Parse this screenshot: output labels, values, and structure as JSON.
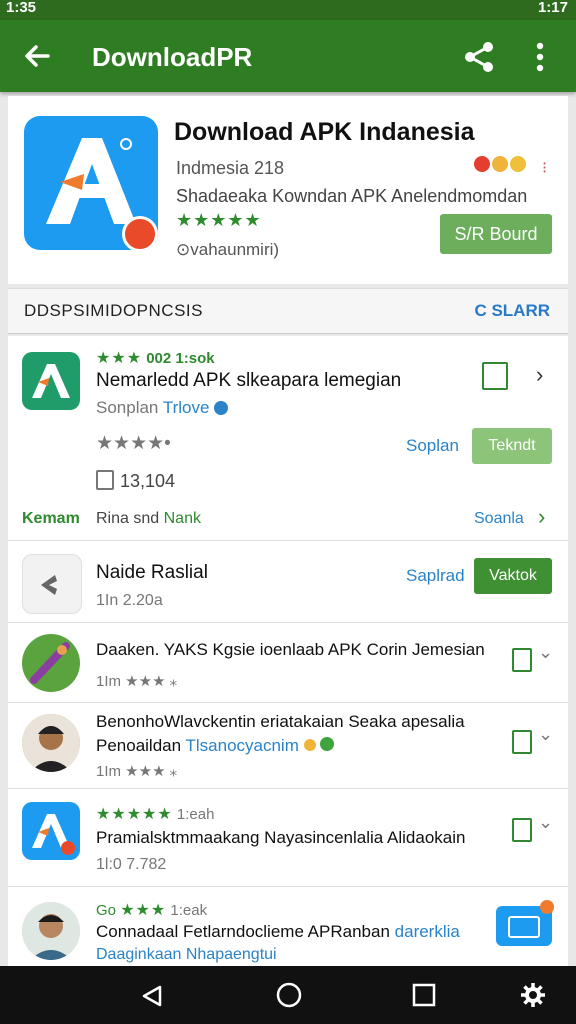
{
  "statusbar": {
    "left": "1:35",
    "right": "1:17"
  },
  "appbar": {
    "title": "DownloadPR"
  },
  "header_card": {
    "title": "Download APK Indanesia",
    "subtitle": "Indmesia 218",
    "description": "Shadaeaka Kowndan APK Anelendmomdan",
    "rating_stars": "★★★★★",
    "footer": "⊙vahaunmiri)",
    "button": "S/R Bourd"
  },
  "section": {
    "title": "DDSPSIMIDOPNCSIS",
    "action": "C SLARR"
  },
  "item1": {
    "stars": "★★★",
    "meta": "002 1:sok",
    "title": "Nemarledd APK slkeapara lemegian",
    "author_prefix": "Sonplan",
    "author": "Trlove",
    "rating": "★★★★•",
    "count": "13,104",
    "link_label": "Soplan",
    "button": "Tekndt"
  },
  "item1_footer": {
    "left": "Kemam",
    "middle": "Rina snd",
    "middle_green": "Nank",
    "right": "Soanla"
  },
  "item2": {
    "title": "Naide Raslial",
    "sub": "1In 2.20a",
    "link_label": "Saplrad",
    "button": "Vaktok"
  },
  "item3": {
    "title": "Daaken. YAKS Kgsie ioenlaab APK Corin Jemesian",
    "sub": "1Im ★★★ ⁎"
  },
  "item4": {
    "title1": "BenonhoWlavckentin eriatakaian Seaka apesalia",
    "title2_black": "Penoaildan",
    "title2_blue": "Tlsanocyacnim",
    "sub": "1Im ★★★ ⁎"
  },
  "item5": {
    "stars": "★★★★★",
    "meta": "1:eah",
    "title": "Pramialsktmmaakang Nayasincenlalia Alidaokain",
    "sub": "1l:0 7.782"
  },
  "item6": {
    "meta_prefix": "Go",
    "stars": "★★★",
    "meta": "1:eak",
    "title_black": "Connadaal Fetlarndoclieme APRanban",
    "title_blue": "darerklia",
    "sub": "Daaginkaan Nhapaengtui"
  },
  "colors": {
    "appbar": "#2f7d22",
    "accent_green": "#2f8a2f",
    "link_blue": "#2a83c8",
    "icon_blue": "#1d9bf0"
  }
}
